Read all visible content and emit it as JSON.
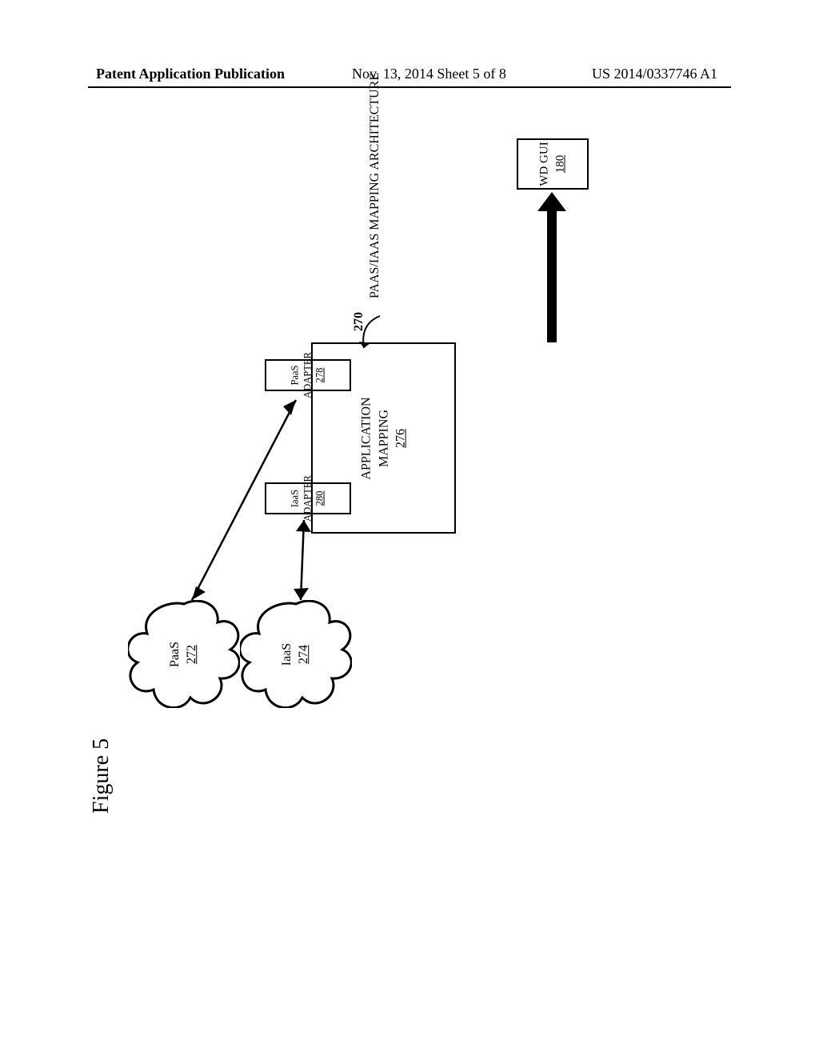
{
  "header": {
    "left": "Patent Application Publication",
    "center": "Nov. 13, 2014  Sheet 5 of 8",
    "right": "US 2014/0337746 A1"
  },
  "figure_label": "Figure 5",
  "architecture": {
    "title": "PAAS/IAAS MAPPING ARCHITECTURE",
    "ref": "270"
  },
  "app_mapping": {
    "label": "APPLICATION\nMAPPING",
    "ref": "276"
  },
  "paas_adapter": {
    "label": "PaaS\nADAPTER",
    "ref": "278"
  },
  "iaas_adapter": {
    "label": "IaaS\nADAPTER",
    "ref": "280"
  },
  "wd_gui": {
    "label": "WD GUI",
    "ref": "180"
  },
  "paas_cloud": {
    "label": "PaaS",
    "ref": "272"
  },
  "iaas_cloud": {
    "label": "IaaS",
    "ref": "274"
  }
}
